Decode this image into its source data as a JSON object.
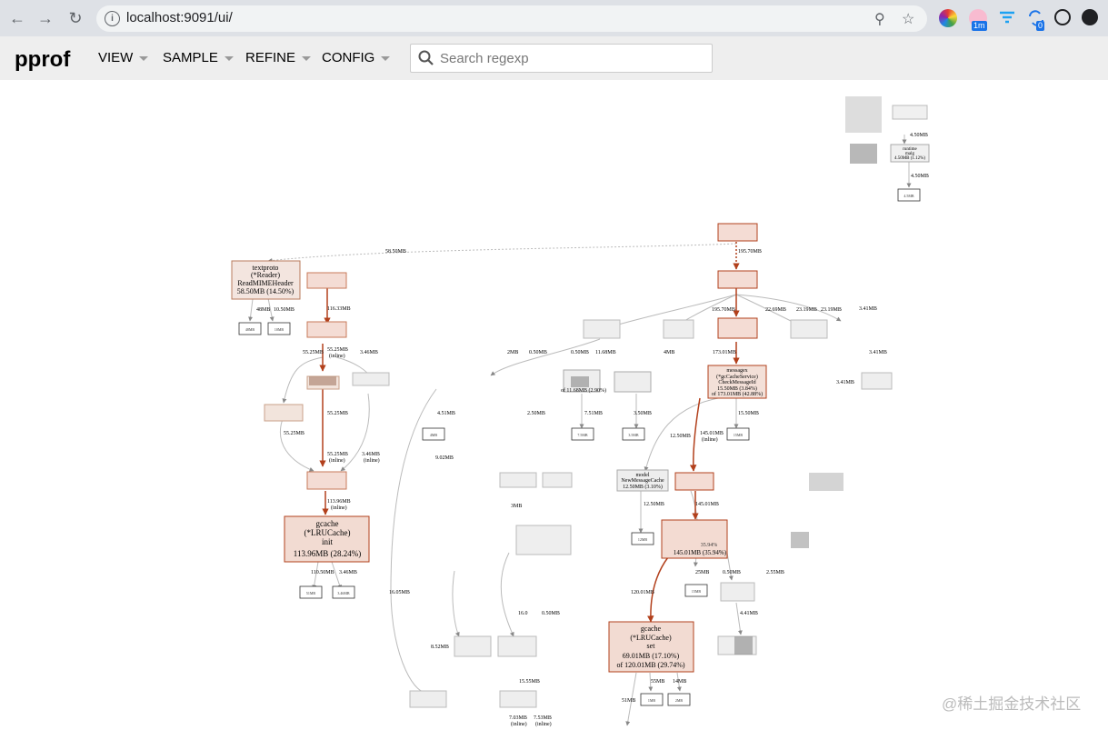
{
  "browser": {
    "url": "localhost:9091/ui/",
    "ext_badges": [
      "1m",
      "0"
    ]
  },
  "app": {
    "logo": "pprof",
    "menu": [
      "VIEW",
      "SAMPLE",
      "REFINE",
      "CONFIG"
    ],
    "search_placeholder": "Search regexp"
  },
  "graph": {
    "nodes": {
      "textproto": [
        "textproto",
        "(*Reader)",
        "ReadMIMEHeader",
        "58.50MB (14.50%)"
      ],
      "lru_init": [
        "gcache",
        "(*LRUCache)",
        "init",
        "113.96MB (28.24%)"
      ],
      "messagex": [
        "messagex",
        "(*gcCacheService)",
        "CheckMessageId",
        "15.50MB (3.84%)",
        "of 173.01MB (42.88%)"
      ],
      "model": [
        "model",
        "NewMessageCache",
        "12.50MB (3.10%)"
      ],
      "lru_set": [
        "gcache",
        "(*LRUCache)",
        "set",
        "69.01MB (17.10%)",
        "of 120.01MB (29.74%)"
      ],
      "runtime_malg": [
        "runtime",
        "malg",
        "4.50MB (1.12%)"
      ],
      "bucket": "of 11.68MB (2.90%)",
      "pct1": "35.94%",
      "pct2": "145.01MB (35.94%)"
    },
    "edges": {
      "e1": "58.50MB",
      "e2": "195.70MB",
      "e3": "116.33MB",
      "e4": "55.25MB",
      "e5": "55.25MB",
      "e5b": "(inline)",
      "e6": "3.46MB",
      "e7": "55.25MB",
      "e8": "55.25MB",
      "e8b": "(inline)",
      "e9": "3.46MB",
      "e9b": "(inline)",
      "e10": "113.96MB",
      "e10b": "(inline)",
      "e11": "110.50MB",
      "e12": "3.46MB",
      "e13": "195.70MB",
      "e14": "22.69MB",
      "e15": "23.19MB",
      "e16": "173.01MB",
      "e17": "12.50MB",
      "e18": "145.01MB",
      "e18b": "(inline)",
      "e19": "15.50MB",
      "e20": "12.50MB",
      "e21": "145.01MB",
      "e22": "120.01MB",
      "e23": "25MB",
      "e24": "0.50MB",
      "e25": "2.55MB",
      "e26": "55MB",
      "e27": "14MB",
      "e28": "51MB",
      "e29": "4.50MB",
      "e30": "4.50MB",
      "e31": "7.51MB",
      "e32": "3.50MB",
      "e33": "11.68MB",
      "e34": "0.50MB",
      "e35": "2MB",
      "e36": "0.50MB",
      "e37": "4MB",
      "e38": "3.41MB",
      "e39": "16.05MB",
      "e40": "8.52MB",
      "e41": "15.55MB",
      "e42": "7.03MB",
      "e42b": "(inline)",
      "e43": "7.53MB",
      "e43b": "(inline)",
      "e44": "4.51MB",
      "e45": "2.50MB",
      "e46": "9.02MB",
      "e47": "3MB",
      "e48": "16.0",
      "e49": "0.50MB",
      "e50": "4.41MB",
      "e51": "3.41MB",
      "e52": "10.50MB",
      "e53": "48MB"
    },
    "boxes": {
      "b1": "51MB",
      "b2": "3.46MB",
      "b3": "48MB",
      "b4": "10MB",
      "b5": "4MB",
      "b6": "7.5MB",
      "b7": "3.5MB",
      "b8": "1MB",
      "b9": "12MB",
      "b10": "15MB",
      "b11": "4.5MB",
      "b12": "1MB",
      "b13": "2MB"
    }
  },
  "watermark": "@稀土掘金技术社区"
}
